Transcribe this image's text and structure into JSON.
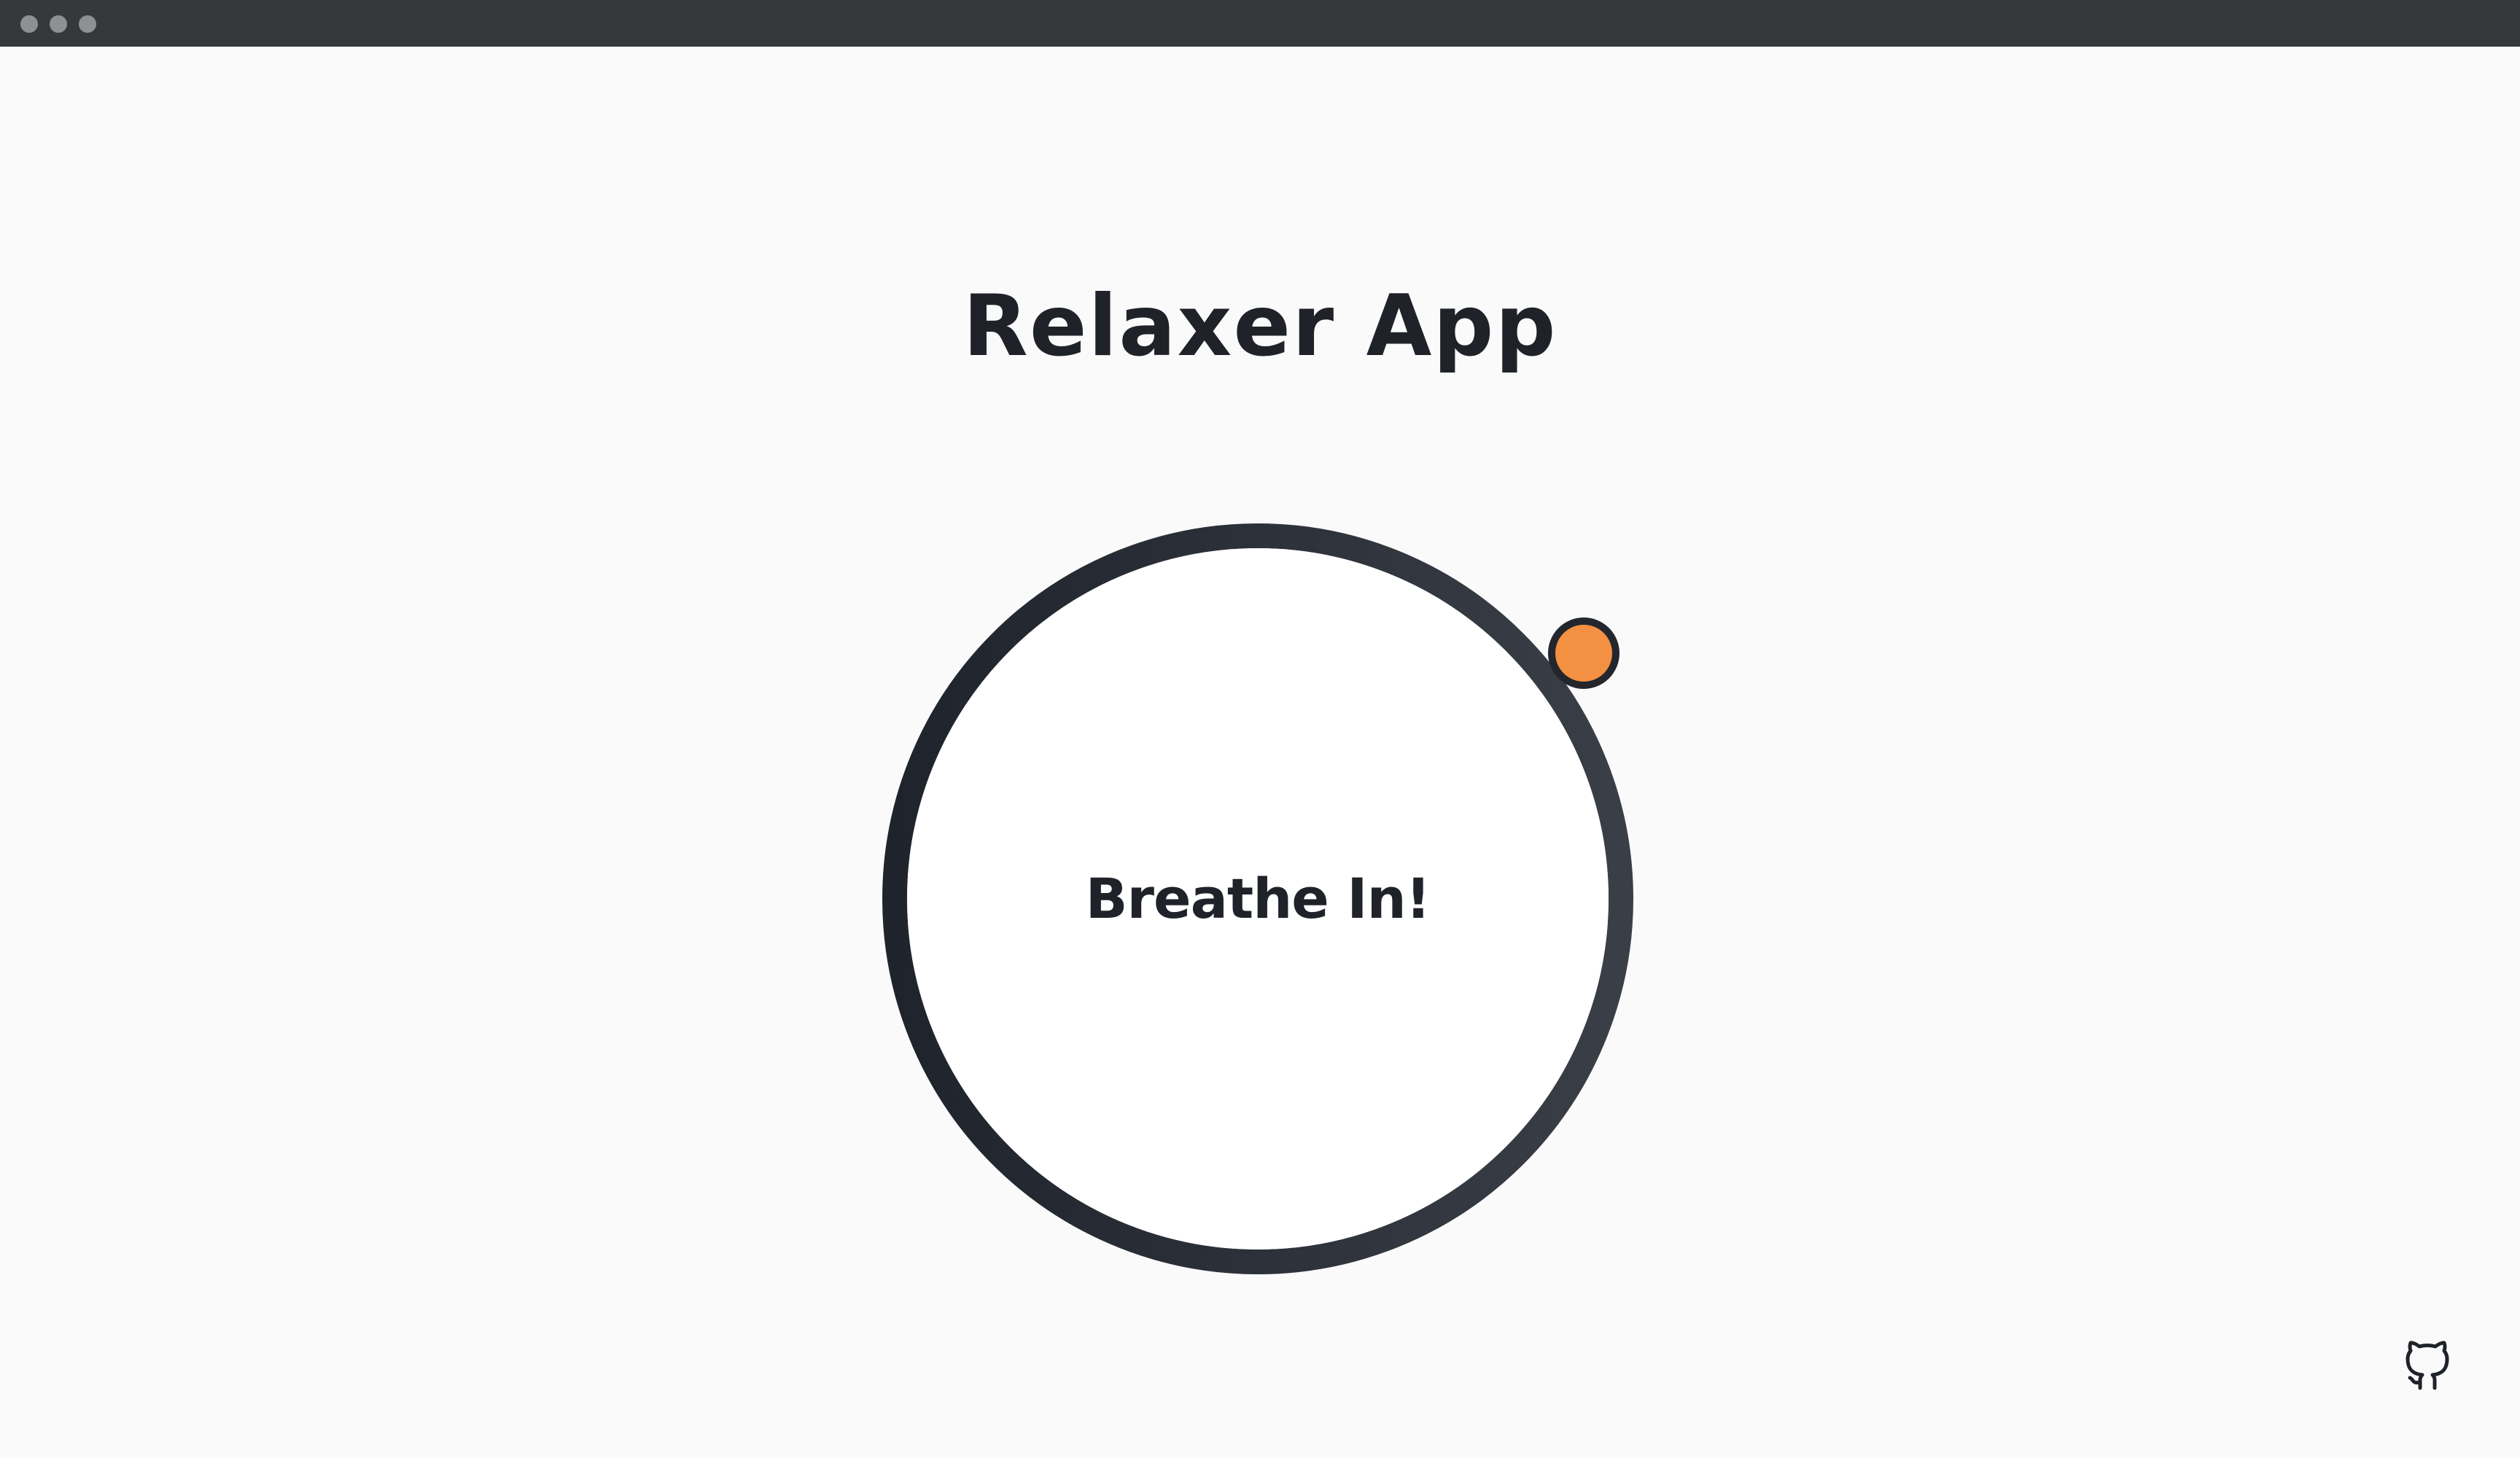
{
  "window": {
    "controls": [
      "close",
      "minimize",
      "maximize"
    ]
  },
  "app": {
    "title": "Relaxer App"
  },
  "breather": {
    "instruction": "Breathe In!",
    "phase_colors": {
      "inhale": "#1f242c",
      "hold": "#3a3e46",
      "exhale": "#6e6d75"
    },
    "pointer_color": "#f39041",
    "pointer_border": "#23262d",
    "inner_fill": "#ffffff"
  },
  "footer": {
    "github_icon": "github-icon"
  }
}
